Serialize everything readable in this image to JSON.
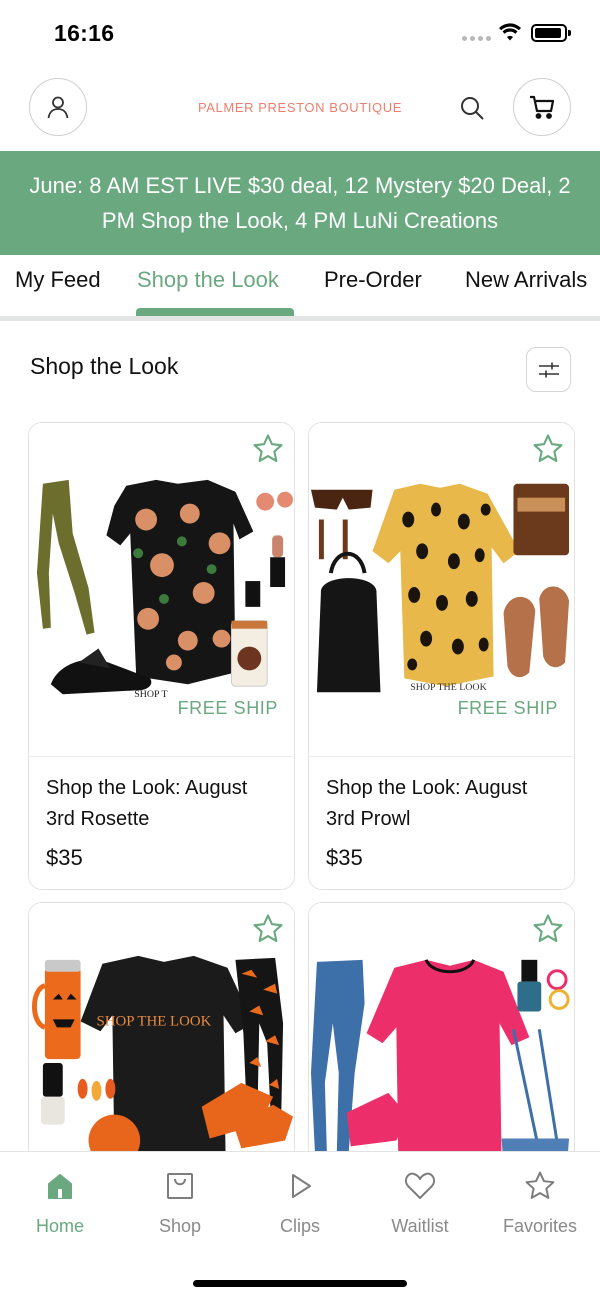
{
  "status_bar": {
    "time": "16:16"
  },
  "header": {
    "brand": "PALMER PRESTON BOUTIQUE",
    "profile_icon": "person-icon",
    "search_icon": "search-icon",
    "cart_icon": "cart-icon"
  },
  "banner": {
    "text": "June: 8 AM EST LIVE $30 deal, 12 Mystery $20 Deal, 2 PM Shop the Look, 4 PM LuNi Creations"
  },
  "tabs": [
    {
      "label": "My Feed",
      "active": false
    },
    {
      "label": "Shop the Look",
      "active": true
    },
    {
      "label": "Pre-Order",
      "active": false
    },
    {
      "label": "New Arrivals",
      "active": false
    }
  ],
  "section": {
    "title": "Shop the Look",
    "filter_icon": "sliders-icon"
  },
  "products": [
    {
      "title": "Shop the Look: August 3rd Rosette",
      "price": "$35",
      "badge": "FREE SHIP",
      "image_text": "SHOP T",
      "favorite_icon": "star-icon"
    },
    {
      "title": "Shop the Look: August 3rd Prowl",
      "price": "$35",
      "badge": "FREE SHIP",
      "image_text": "SHOP THE LOOK",
      "favorite_icon": "star-icon"
    },
    {
      "title": "",
      "price": "",
      "image_text": "SHOP THE LOOK",
      "favorite_icon": "star-icon"
    },
    {
      "title": "",
      "price": "",
      "favorite_icon": "star-icon"
    }
  ],
  "bottom_nav": [
    {
      "label": "Home",
      "icon": "home-icon",
      "active": true
    },
    {
      "label": "Shop",
      "icon": "shopping-bag-icon",
      "active": false
    },
    {
      "label": "Clips",
      "icon": "play-icon",
      "active": false
    },
    {
      "label": "Waitlist",
      "icon": "heart-icon",
      "active": false
    },
    {
      "label": "Favorites",
      "icon": "star-icon",
      "active": false
    }
  ],
  "colors": {
    "accent": "#6aa980",
    "brand": "#f07d6d",
    "text": "#111111",
    "muted": "#8a8a8a"
  }
}
